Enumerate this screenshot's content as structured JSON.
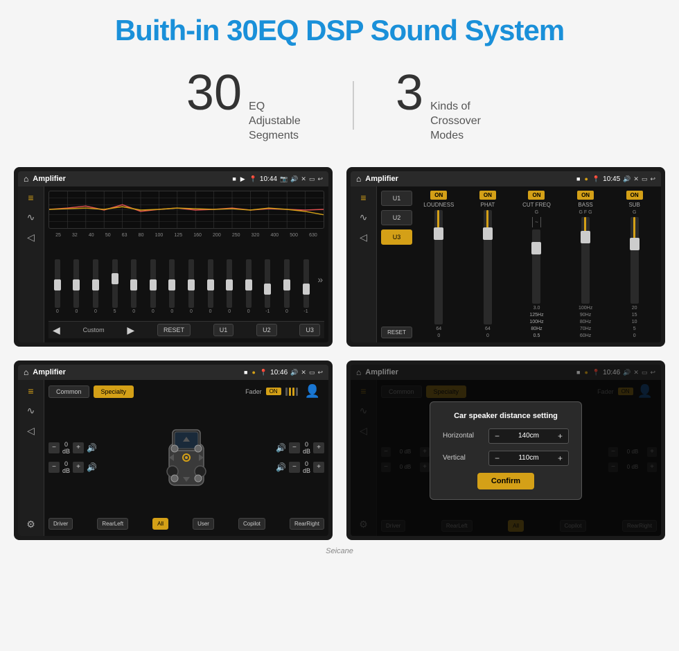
{
  "page": {
    "title": "Buith-in 30EQ DSP Sound System",
    "stat1_number": "30",
    "stat1_label": "EQ Adjustable\nSegments",
    "stat2_number": "3",
    "stat2_label": "Kinds of\nCrossover Modes"
  },
  "screen1": {
    "title": "Amplifier",
    "time": "10:44",
    "eq_labels": [
      "25",
      "32",
      "40",
      "50",
      "63",
      "80",
      "100",
      "125",
      "160",
      "200",
      "250",
      "320",
      "400",
      "500",
      "630"
    ],
    "eq_values": [
      "0",
      "0",
      "0",
      "0",
      "5",
      "0",
      "0",
      "0",
      "0",
      "0",
      "0",
      "0",
      "-1",
      "0",
      "-1"
    ],
    "bottom_buttons": [
      "RESET",
      "U1",
      "U2",
      "U3"
    ],
    "preset_label": "Custom"
  },
  "screen2": {
    "title": "Amplifier",
    "time": "10:45",
    "presets": [
      "U1",
      "U2",
      "U3"
    ],
    "active_preset": "U3",
    "channels": [
      "LOUDNESS",
      "PHAT",
      "CUT FREQ",
      "BASS",
      "SUB"
    ],
    "channel_types": [
      "",
      "",
      "G",
      "G F G",
      "G"
    ],
    "reset_label": "RESET",
    "on_label": "ON"
  },
  "screen3": {
    "title": "Amplifier",
    "time": "10:46",
    "tabs": [
      "Common",
      "Specialty"
    ],
    "active_tab": "Specialty",
    "fader_label": "Fader",
    "fader_on": "ON",
    "volumes": [
      "0 dB",
      "0 dB",
      "0 dB",
      "0 dB"
    ],
    "bottom_buttons": [
      "Driver",
      "RearLeft",
      "All",
      "User",
      "Copilot",
      "RearRight"
    ],
    "active_bottom": "All"
  },
  "screen4": {
    "title": "Amplifier",
    "time": "10:46",
    "tabs": [
      "Common",
      "Specialty"
    ],
    "active_tab": "Specialty",
    "dialog_title": "Car speaker distance setting",
    "horizontal_label": "Horizontal",
    "horizontal_value": "140cm",
    "vertical_label": "Vertical",
    "vertical_value": "110cm",
    "confirm_label": "Confirm",
    "bottom_buttons": [
      "Driver",
      "RearLeft",
      "All",
      "User",
      "Copilot",
      "RearRight"
    ],
    "right_labels": [
      "0 dB",
      "0 dB"
    ]
  },
  "watermark": "Seicane"
}
